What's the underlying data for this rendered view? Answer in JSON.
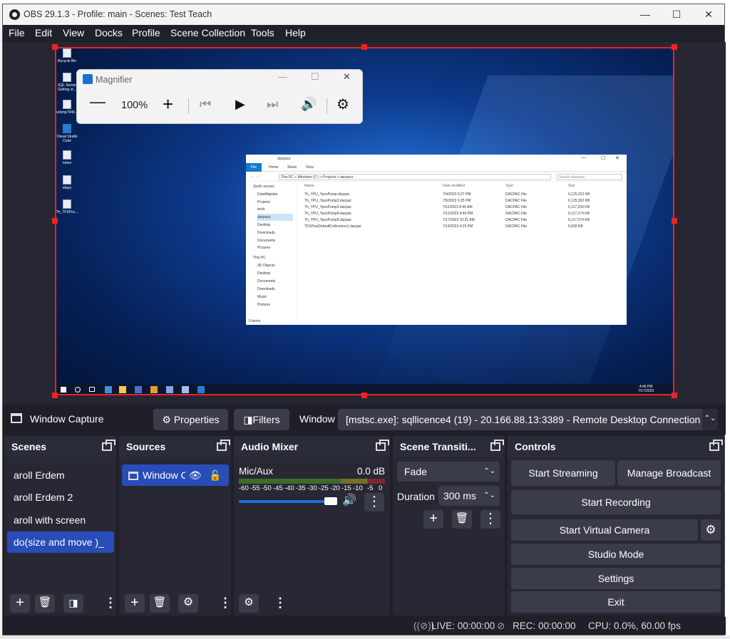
{
  "window": {
    "title": "OBS 29.1.3 - Profile: main - Scenes: Test Teach",
    "minimize": "—",
    "maximize": "☐",
    "close": "✕"
  },
  "menu": [
    "File",
    "Edit",
    "View",
    "Docks",
    "Profile",
    "Scene Collection",
    "Tools",
    "Help"
  ],
  "preview": {
    "desktop_icons": [
      "Recycle Bin",
      "SQL Server Getting st...",
      "vcbmp7940...",
      "Visual Studio Code",
      "notes",
      "steps",
      "Th_TFSPoc..."
    ],
    "magnifier": {
      "title": "Magnifier",
      "zoom": "100%",
      "minus": "—",
      "plus": "+"
    },
    "explorer": {
      "title": "dacpacs",
      "tabs": [
        "File",
        "Home",
        "Share",
        "View"
      ],
      "address": "This PC  >  Windows (C:)  >  Projects  >  dacpacs",
      "search_placeholder": "Search dacpacs",
      "nav": [
        "Quick access",
        "DataMigratio",
        "Projects",
        "tools",
        "dacpacs",
        "Desktop",
        "Downloads",
        "Documents",
        "Pictures",
        "This PC",
        "3D Objects",
        "Desktop",
        "Documents",
        "Downloads",
        "Music",
        "Pictures"
      ],
      "columns": [
        "Name",
        "Date modified",
        "Type",
        "Size"
      ],
      "files": [
        {
          "name": "Th_YPU_YpsoPump.dacpac",
          "date": "7/4/2023 5:27 PM",
          "type": "DACPAC File",
          "size": "6,125,322 KB"
        },
        {
          "name": "Th_YPU_YpsoPump2.dacpac",
          "date": "7/5/2023 6:25 PM",
          "type": "DACPAC File",
          "size": "6,125,302 KB"
        },
        {
          "name": "Th_YPU_YpsoPump3.dacpac",
          "date": "7/11/2023 8:45 AM",
          "type": "DACPAC File",
          "size": "6,117,234 KB"
        },
        {
          "name": "Th_YPU_YpsoPump4.dacpac",
          "date": "7/12/2023 4:44 PM",
          "type": "DACPAC File",
          "size": "6,117,274 KB"
        },
        {
          "name": "Th_YPU_YpsoPump5.dacpac",
          "date": "7/17/2023 10:31 AM",
          "type": "DACPAC File",
          "size": "6,117,274 KB"
        },
        {
          "name": "TFSPostDefaultCollections1.dacpac",
          "date": "7/14/2023 4:25 PM",
          "type": "DACPAC File",
          "size": "5,830 KB"
        }
      ],
      "status": "6 items"
    },
    "clock": {
      "time": "4:46 PM",
      "date": "7/17/2023"
    }
  },
  "source_toolbar": {
    "source_name": "Window Capture",
    "properties": "Properties",
    "filters": "Filters",
    "window_label": "Window",
    "window_value": "[mstsc.exe]: sqllicence4 (19) - 20.166.88.13:3389 - Remote Desktop Connection"
  },
  "scenes": {
    "title": "Scenes",
    "items": [
      "aroll Erdem",
      "aroll Erdem 2",
      "aroll with screen",
      "do(size and move )_"
    ]
  },
  "sources": {
    "title": "Sources",
    "items": [
      "Window Capture"
    ]
  },
  "audio_mixer": {
    "title": "Audio Mixer",
    "channel": "Mic/Aux",
    "db": "0.0 dB",
    "scale": [
      "-60",
      "-55",
      "-50",
      "-45",
      "-40",
      "-35",
      "-30",
      "-25",
      "-20",
      "-15",
      "-10",
      "-5",
      "0"
    ],
    "volume_level": 0.95
  },
  "transitions": {
    "title": "Scene Transiti...",
    "value": "Fade",
    "duration_label": "Duration",
    "duration": "300 ms"
  },
  "controls": {
    "title": "Controls",
    "start_streaming": "Start Streaming",
    "manage_broadcast": "Manage Broadcast",
    "start_recording": "Start Recording",
    "start_virtual_camera": "Start Virtual Camera",
    "studio_mode": "Studio Mode",
    "settings": "Settings",
    "exit": "Exit"
  },
  "status": {
    "live": "LIVE: 00:00:00",
    "rec": "REC: 00:00:00",
    "cpu": "CPU: 0.0%, 60.00 fps"
  },
  "colors": {
    "accent": "#284cb8",
    "selection": "#ee2222",
    "panel": "#272834",
    "window_bg": "#1e1f29"
  }
}
